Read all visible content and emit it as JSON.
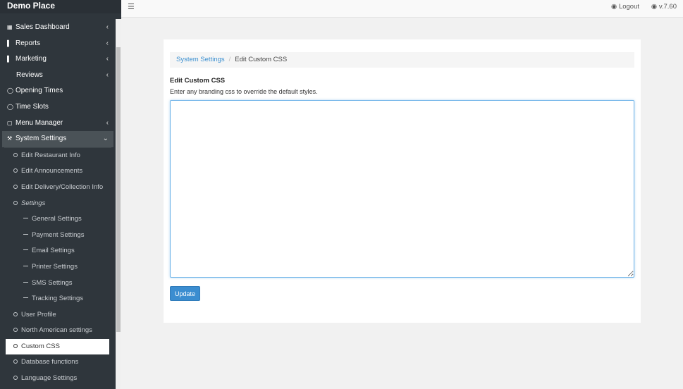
{
  "brand": {
    "title": "Demo Place"
  },
  "topbar": {
    "menu_icon": "hamburger-icon",
    "logout": "Logout",
    "version": "v.7.60"
  },
  "sidebar": {
    "items": [
      {
        "label": "Sales Dashboard",
        "icon": "grid-icon"
      },
      {
        "label": "Reports",
        "icon": "bar-chart-icon"
      },
      {
        "label": "Marketing",
        "icon": "bar-chart-icon"
      },
      {
        "label": "Reviews"
      },
      {
        "label": "Opening Times",
        "icon": "clock-icon"
      },
      {
        "label": "Time Slots",
        "icon": "clock-icon"
      },
      {
        "label": "Menu Manager",
        "icon": "folder-icon"
      },
      {
        "label": "System Settings",
        "icon": "wrench-icon"
      }
    ],
    "system_settings_children": [
      {
        "label": "Edit Restaurant Info"
      },
      {
        "label": "Edit Announcements"
      },
      {
        "label": "Edit Delivery/Collection Info"
      },
      {
        "label": "Settings"
      }
    ],
    "settings_children": [
      {
        "label": "General Settings"
      },
      {
        "label": "Payment Settings"
      },
      {
        "label": "Email Settings"
      },
      {
        "label": "Printer Settings"
      },
      {
        "label": "SMS Settings"
      },
      {
        "label": "Tracking Settings"
      }
    ],
    "more_children": [
      {
        "label": "User Profile"
      },
      {
        "label": "North American settings"
      },
      {
        "label": "Custom CSS"
      },
      {
        "label": "Database functions"
      },
      {
        "label": "Language Settings"
      }
    ]
  },
  "breadcrumb": {
    "parent": "System Settings",
    "separator": "/",
    "current": "Edit Custom CSS"
  },
  "form": {
    "label": "Edit Custom CSS",
    "help": "Enter any branding css to override the default styles.",
    "css_value": "",
    "submit_label": "Update"
  }
}
